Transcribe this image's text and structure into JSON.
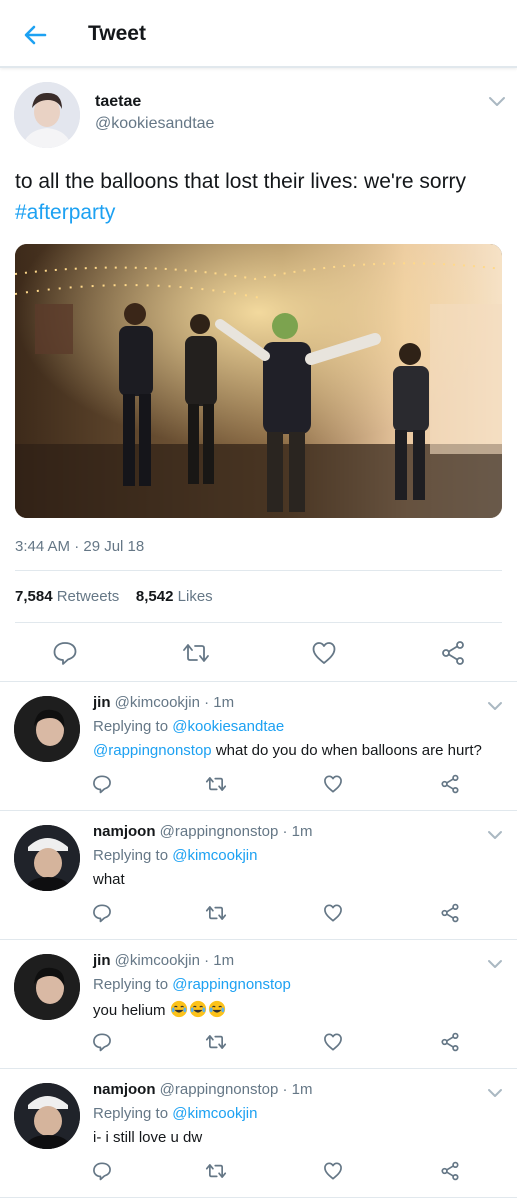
{
  "header": {
    "title": "Tweet",
    "back_icon": "arrow-left-icon"
  },
  "tweet": {
    "display_name": "taetae",
    "handle": "@kookiesandtae",
    "text_plain": "to all the balloons that lost their lives: we're sorry ",
    "hashtag": "#afterparty",
    "timestamp": "3:44 AM · 29 Jul 18",
    "retweets_count": "7,584",
    "retweets_label": "Retweets",
    "likes_count": "8,542",
    "likes_label": "Likes",
    "actions": [
      "reply-icon",
      "retweet-icon",
      "like-icon",
      "share-icon"
    ]
  },
  "replies": [
    {
      "name": "jin",
      "handle": "@kimcookjin",
      "time": "· 1m",
      "replying_label": "Replying to",
      "replying_to": "@kookiesandtae",
      "mention": "@rappingnonstop",
      "text": " what do you do when balloons are hurt?"
    },
    {
      "name": "namjoon",
      "handle": "@rappingnonstop",
      "time": "· 1m",
      "replying_label": "Replying to",
      "replying_to": "@kimcookjin",
      "text": "what"
    },
    {
      "name": "jin",
      "handle": "@kimcookjin",
      "time": "· 1m",
      "replying_label": "Replying to",
      "replying_to": "@rappingnonstop",
      "text": "you helium ",
      "emoji": "😂😂😂"
    },
    {
      "name": "namjoon",
      "handle": "@rappingnonstop",
      "time": "· 1m",
      "replying_label": "Replying to",
      "replying_to": "@kimcookjin",
      "text": "i- i still love u dw"
    }
  ],
  "colors": {
    "accent": "#1da1f2",
    "text": "#14171a",
    "muted": "#657786",
    "divider": "#e1e8ed"
  }
}
